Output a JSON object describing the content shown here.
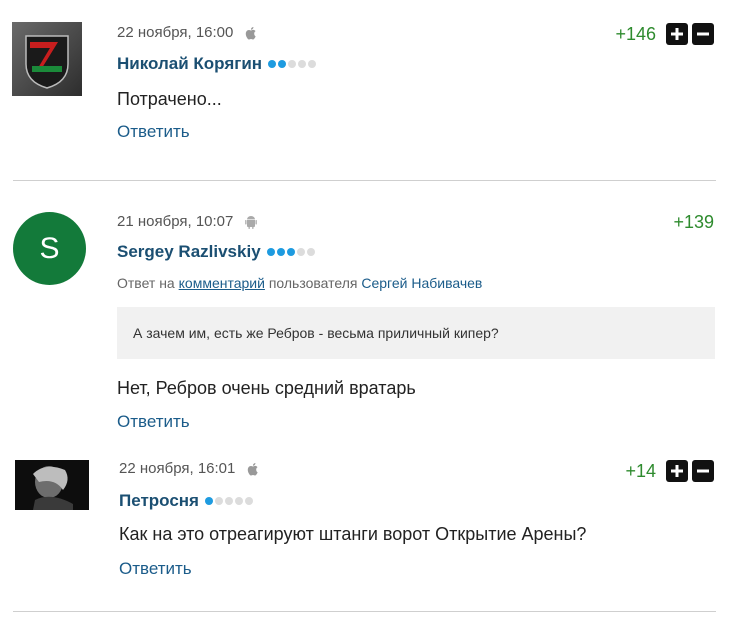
{
  "comments": [
    {
      "date": "22 ноября, 16:00",
      "platform_icon": "apple-icon",
      "author": "Николай Корягин",
      "rank_dots": [
        true,
        true,
        false,
        false,
        false
      ],
      "score": "+146",
      "text": "Потрачено...",
      "reply_label": "Ответить",
      "avatar_icon": "lokomotiv-logo"
    },
    {
      "date": "21 ноября, 10:07",
      "platform_icon": "android-icon",
      "author": "Sergey Razlivskiy",
      "rank_dots": [
        true,
        true,
        true,
        false,
        false
      ],
      "score": "+139",
      "avatar_letter": "S",
      "avatar_color": "#137a3a",
      "reply_to": {
        "prefix": "Ответ на",
        "link": "комментарий",
        "middle": "пользователя",
        "user": "Сергей Набивачев"
      },
      "quote": "А зачем им, есть же Ребров - весьма приличный кипер?",
      "text": "Нет, Ребров очень средний вратарь",
      "reply_label": "Ответить"
    },
    {
      "date": "22 ноября, 16:01",
      "platform_icon": "apple-icon",
      "author": "Петросня",
      "rank_dots": [
        true,
        false,
        false,
        false,
        false
      ],
      "score": "+14",
      "text": "Как на это отреагируют штанги ворот Открытие Арены?",
      "reply_label": "Ответить",
      "avatar_icon": "person-photo"
    }
  ],
  "colors": {
    "author": "#1b4f72",
    "link": "#1b5c8a",
    "score": "#2e8b2e",
    "rank_dot_active": "#1e9be0",
    "rank_dot_inactive": "#dcdcdc"
  }
}
